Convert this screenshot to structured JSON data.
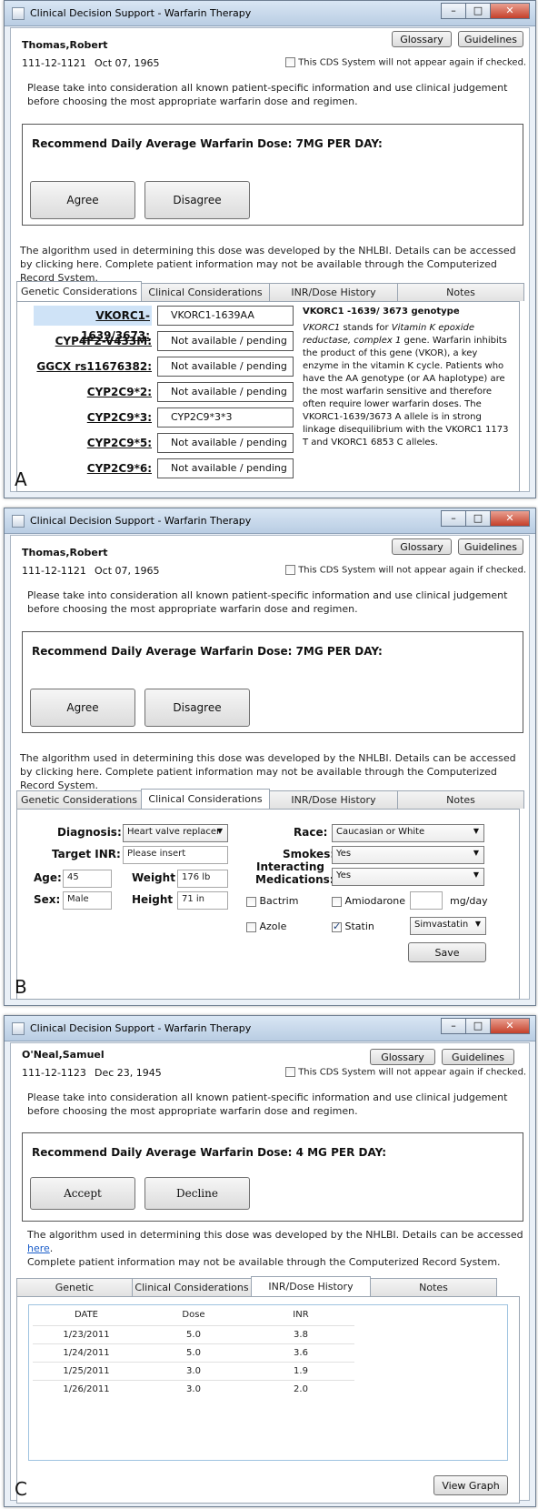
{
  "app_title": "Clinical Decision Support - Warfarin Therapy",
  "window_buttons": {
    "minimize": "–",
    "maximize": "□",
    "close": "✕"
  },
  "common": {
    "glossary": "Glossary",
    "guidelines": "Guidelines",
    "cds_check": "This CDS System will not appear again if checked.",
    "consider_text": "Please take into consideration all known patient-specific information and use clinical judgement before choosing the most appropriate warfarin dose and regimen.",
    "algo_text_1": "The algorithm used in determining this dose was developed by the NHLBI. Details can be accessed by clicking here.  Complete patient information may not be available through the Computerized Record System.",
    "tabs": [
      "Genetic Considerations",
      "Clinical Considerations",
      "INR/Dose History",
      "Notes"
    ]
  },
  "panel_a": {
    "letter": "A",
    "patient_name": "Thomas,Robert",
    "patient_id": "111-12-1121",
    "dob": "Oct 07, 1965",
    "recommendation": "Recommend Daily Average Warfarin Dose: 7MG PER DAY:",
    "agree": "Agree",
    "disagree": "Disagree",
    "genes": [
      {
        "label": "VKORC1-1639/3673:",
        "value": "VKORC1-1639AA"
      },
      {
        "label": "CYP4F2-V433M:",
        "value": "Not available / pending"
      },
      {
        "label": "GGCX rs11676382:",
        "value": "Not available / pending"
      },
      {
        "label": "CYP2C9*2:",
        "value": "Not available / pending"
      },
      {
        "label": "CYP2C9*3:",
        "value": "CYP2C9*3*3"
      },
      {
        "label": "CYP2C9*5:",
        "value": "Not available / pending"
      },
      {
        "label": "CYP2C9*6:",
        "value": "Not available / pending"
      }
    ],
    "desc_title": "VKORC1 -1639/ 3673 genotype",
    "desc_italic": "VKORC1",
    "desc_body_1": " stands for ",
    "desc_italic_2": "Vitamin K epoxide reductase, complex 1",
    "desc_body_2": " gene.  Warfarin inhibits the product of this gene (VKOR), a key enzyme in the vitamin K cycle. Patients who have the AA genotype (or AA haplotype) are the most warfarin sensitive and therefore often require lower warfarin doses.  The VKORC1-1639/3673 A allele is in strong linkage disequilibrium with the VKORC1 1173 T and VKORC1 6853 C alleles."
  },
  "panel_b": {
    "letter": "B",
    "patient_name": "Thomas,Robert",
    "patient_id": "111-12-1121",
    "dob": "Oct 07, 1965",
    "recommendation": "Recommend Daily Average Warfarin Dose: 7MG PER DAY:",
    "agree": "Agree",
    "disagree": "Disagree",
    "diagnosis_label": "Diagnosis:",
    "diagnosis_value": "Heart valve replacer",
    "target_inr_label": "Target INR:",
    "target_inr_value": "Please insert",
    "age_label": "Age:",
    "age_value": "45",
    "weight_label": "Weight",
    "weight_value": "176 lb",
    "sex_label": "Sex:",
    "sex_value": "Male",
    "height_label": "Height",
    "height_value": "71 in",
    "race_label": "Race:",
    "race_value": "Caucasian or White",
    "smokes_label": "Smokes:",
    "smokes_value": "Yes",
    "interacting_label": "Interacting Medications:",
    "interacting_value": "Yes",
    "meds": {
      "bactrim": "Bactrim",
      "amiodarone": "Amiodarone",
      "azole": "Azole",
      "statin": "Statin"
    },
    "statin_checked": true,
    "mg_day": "mg/day",
    "statin_select": "Simvastatin",
    "save": "Save"
  },
  "panel_c": {
    "letter": "C",
    "patient_name": "O'Neal,Samuel",
    "patient_id": "111-12-1123",
    "dob": "Dec 23, 1945",
    "recommendation": "Recommend Daily Average Warfarin Dose: 4   MG PER DAY:",
    "accept": "Accept",
    "decline": "Decline",
    "algo_prefix": "The algorithm used in determining this dose was developed by the NHLBI. Details can be accessed ",
    "algo_link": "here",
    "algo_suffix": ".",
    "algo_line2": "Complete patient information may not be available through the Computerized Record System.",
    "table_headers": [
      "DATE",
      "Dose",
      "INR"
    ],
    "rows": [
      [
        "1/23/2011",
        "5.0",
        "3.8"
      ],
      [
        "1/24/2011",
        "5.0",
        "3.6"
      ],
      [
        "1/25/2011",
        "3.0",
        "1.9"
      ],
      [
        "1/26/2011",
        "3.0",
        "2.0"
      ]
    ],
    "view_graph": "View Graph"
  }
}
